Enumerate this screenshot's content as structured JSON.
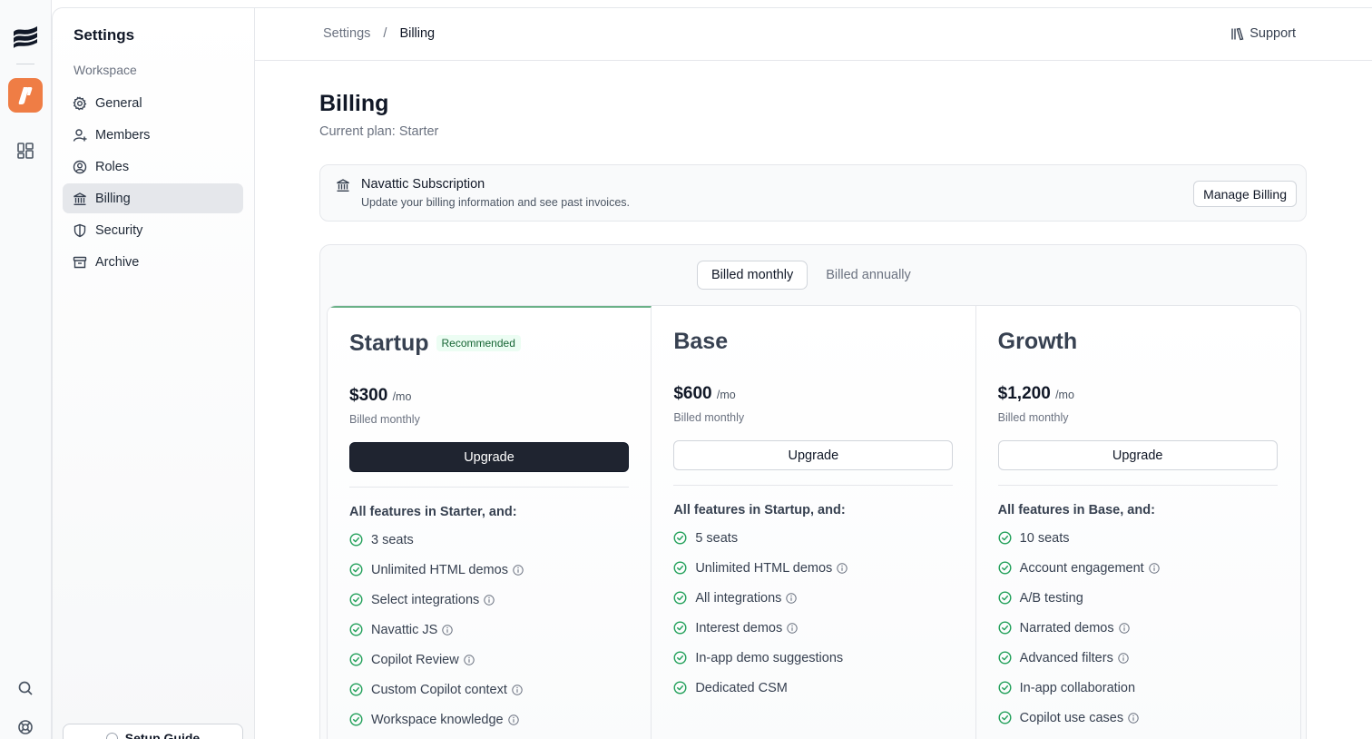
{
  "sidebar": {
    "title": "Settings",
    "group_label": "Workspace",
    "items": [
      {
        "label": "General",
        "icon": "gear-icon",
        "active": false
      },
      {
        "label": "Members",
        "icon": "user-plus-icon",
        "active": false
      },
      {
        "label": "Roles",
        "icon": "user-circle-icon",
        "active": false
      },
      {
        "label": "Billing",
        "icon": "bank-icon",
        "active": true
      },
      {
        "label": "Security",
        "icon": "shield-icon",
        "active": false
      },
      {
        "label": "Archive",
        "icon": "archive-icon",
        "active": false
      }
    ],
    "setup_guide_label": "Setup Guide"
  },
  "topbar": {
    "breadcrumb": [
      "Settings",
      "/",
      "Billing"
    ],
    "support_label": "Support"
  },
  "page": {
    "title": "Billing",
    "current_plan": "Current plan: Starter"
  },
  "subscription": {
    "title": "Navattic Subscription",
    "description": "Update your billing information and see past invoices.",
    "manage_label": "Manage Billing"
  },
  "billing_toggle": {
    "monthly": "Billed monthly",
    "annually": "Billed annually",
    "selected": "monthly"
  },
  "plans": [
    {
      "name": "Startup",
      "badge": "Recommended",
      "price": "$300",
      "per": "/mo",
      "billed": "Billed monthly",
      "cta": "Upgrade",
      "primary": true,
      "features_heading": "All features in Starter, and:",
      "features": [
        {
          "text": "3 seats",
          "info": false
        },
        {
          "text": "Unlimited HTML demos",
          "info": true
        },
        {
          "text": "Select integrations",
          "info": true
        },
        {
          "text": "Navattic JS",
          "info": true
        },
        {
          "text": "Copilot Review",
          "info": true
        },
        {
          "text": "Custom Copilot context",
          "info": true
        },
        {
          "text": "Workspace knowledge",
          "info": true
        }
      ]
    },
    {
      "name": "Base",
      "badge": "",
      "price": "$600",
      "per": "/mo",
      "billed": "Billed monthly",
      "cta": "Upgrade",
      "primary": false,
      "features_heading": "All features in Startup, and:",
      "features": [
        {
          "text": "5 seats",
          "info": false
        },
        {
          "text": "Unlimited HTML demos",
          "info": true
        },
        {
          "text": "All integrations",
          "info": true
        },
        {
          "text": "Interest demos",
          "info": true
        },
        {
          "text": "In-app demo suggestions",
          "info": false
        },
        {
          "text": "Dedicated CSM",
          "info": false
        }
      ]
    },
    {
      "name": "Growth",
      "badge": "",
      "price": "$1,200",
      "per": "/mo",
      "billed": "Billed monthly",
      "cta": "Upgrade",
      "primary": false,
      "features_heading": "All features in Base, and:",
      "features": [
        {
          "text": "10 seats",
          "info": false
        },
        {
          "text": "Account engagement",
          "info": true
        },
        {
          "text": "A/B testing",
          "info": false
        },
        {
          "text": "Narrated demos",
          "info": true
        },
        {
          "text": "Advanced filters",
          "info": true
        },
        {
          "text": "In-app collaboration",
          "info": false
        },
        {
          "text": "Copilot use cases",
          "info": true
        }
      ]
    }
  ],
  "colors": {
    "accent_orange": "#ef7d45",
    "check_green": "#22a05a",
    "recommended_border": "#6ab187",
    "primary_button": "#1f2430"
  }
}
